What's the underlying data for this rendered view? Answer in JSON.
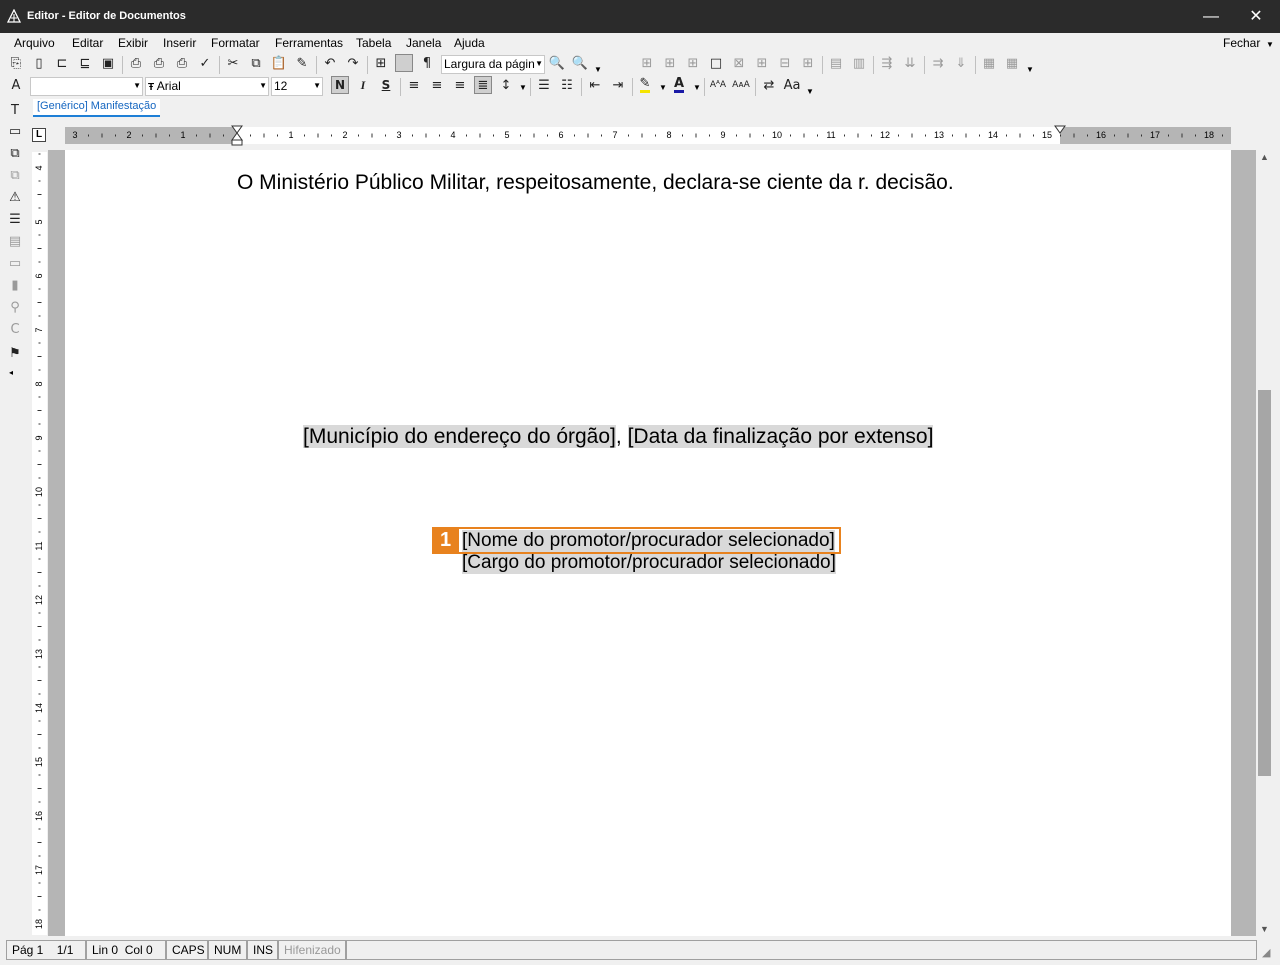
{
  "window": {
    "title": "Editor - Editor de Documentos",
    "minimize_glyph": "—",
    "close_glyph": "✕"
  },
  "menu": {
    "items": [
      "Arquivo",
      "Editar",
      "Exibir",
      "Inserir",
      "Formatar",
      "Ferramentas",
      "Tabela",
      "Janela",
      "Ajuda"
    ],
    "close_label": "Fechar"
  },
  "toolbar": {
    "zoom_value": "Largura da págin",
    "style_value": "",
    "font_value": "Arial",
    "size_value": "12",
    "bold_label": "N",
    "italic_label": "I",
    "underline_label": "S",
    "pilcrow_label": "¶"
  },
  "tab": {
    "label": "[Genérico] Manifestação"
  },
  "ruler": {
    "marks_left": [
      "3",
      "2",
      "1"
    ],
    "marks_right": [
      "1",
      "2",
      "3",
      "4",
      "5",
      "6",
      "7",
      "8",
      "9",
      "10",
      "11",
      "12",
      "13",
      "14",
      "15",
      "16",
      "17",
      "18"
    ]
  },
  "vruler": {
    "marks": [
      "4",
      "5",
      "6",
      "7",
      "8",
      "9",
      "10",
      "11",
      "12",
      "13",
      "14",
      "15",
      "16",
      "17",
      "18"
    ]
  },
  "document": {
    "line1": "O Ministério Público Militar, respeitosamente, declara-se ciente da r. decisão.",
    "field_city": "[Município do endereço do órgão]",
    "separator": ", ",
    "field_date": "[Data da finalização por extenso]",
    "field_name": "[Nome do promotor/procurador selecionado]",
    "field_role": "[Cargo do promotor/procurador selecionado]",
    "marker_number": "1"
  },
  "status": {
    "page": "Pág 1",
    "pages": "1/1",
    "line": "Lin 0",
    "col": "Col 0",
    "caps": "CAPS",
    "num": "NUM",
    "ins": "INS",
    "hyphen": "Hifenizado"
  },
  "colors": {
    "titlebar": "#2b2b2b",
    "marker": "#e8821e",
    "field_bg": "#d9d9d9",
    "tab_accent": "#1e7fd6"
  }
}
